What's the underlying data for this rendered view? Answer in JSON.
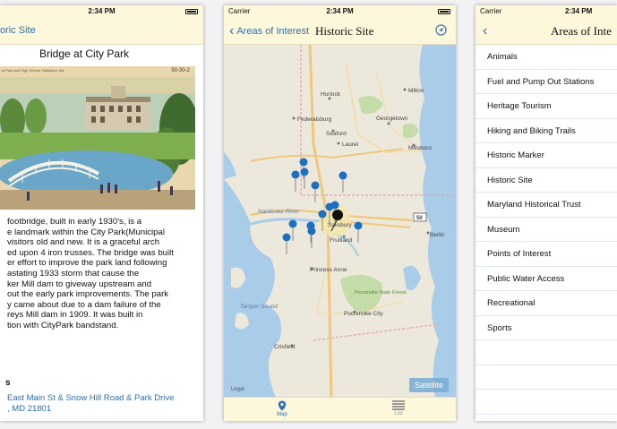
{
  "status": {
    "carrier": "Carrier",
    "time": "2:34 PM"
  },
  "screen1": {
    "back_label": "oric Site",
    "title": "Bridge at City Park",
    "postcard_caption": "al Park and High School. Salisbury, Md.",
    "postcard_number": "50-30-2",
    "description_lines": [
      "footbridge, built in early 1930's, is a",
      "e landmark within the City Park(Municipal",
      "visitors old and new.  It is a graceful arch",
      "ed upon 4 iron trusses. The bridge was built",
      "er effort to improve the park land following",
      "astating 1933 storm that cause the",
      "ker Mill dam to giveway upstream and",
      "out the early park improvements. The park",
      "y came about due to a dam failure of the",
      "reys Mill dam in 1909. It was built in",
      "tion with CityPark bandstand."
    ],
    "address_label": "s",
    "address_lines": [
      "East Main St & Snow Hill Road & Park Drive",
      ", MD 21801"
    ]
  },
  "screen2": {
    "back_label": "Areas of Interest",
    "title": "Historic Site",
    "map_labels": {
      "federalsburg": "Federalsburg",
      "hurlock": "Hurlock",
      "milton": "Milton",
      "georgetown": "Georgetown",
      "seaford": "Seaford",
      "laurel": "Laurel",
      "millsboro": "Millsboro",
      "nanticoke": "Nanticoke River",
      "salisbury": "Salisbury",
      "fruitland": "Fruitland",
      "berlin": "Berlin",
      "princess_anne": "Princess Anne",
      "pocomoke_forest": "Pocomoke State Forest",
      "pocomoke_city": "Pocomoke City",
      "tangier": "Tangier Sound",
      "crisfield": "Crisfield",
      "route": "50"
    },
    "satellite_label": "Satellite",
    "legal_label": "Legal",
    "tabs": {
      "map": "Map",
      "list": "List"
    }
  },
  "screen3": {
    "back_label": "",
    "title": "Areas of Inte",
    "items": [
      "Animals",
      "Fuel and Pump Out Stations",
      "Heritage Tourism",
      "Hiking and Biking Trails",
      "Historic Marker",
      "Historic Site",
      "Maryland Historical Trust",
      "Museum",
      "Points of Interest",
      "Public Water Access",
      "Recreational",
      "Sports"
    ]
  },
  "colors": {
    "accent": "#2a6fb8",
    "bar": "#fdf8dc",
    "water": "#a9cde8",
    "land": "#ece8dc",
    "park": "#c3dca8",
    "pin": "#1d6fbf"
  }
}
